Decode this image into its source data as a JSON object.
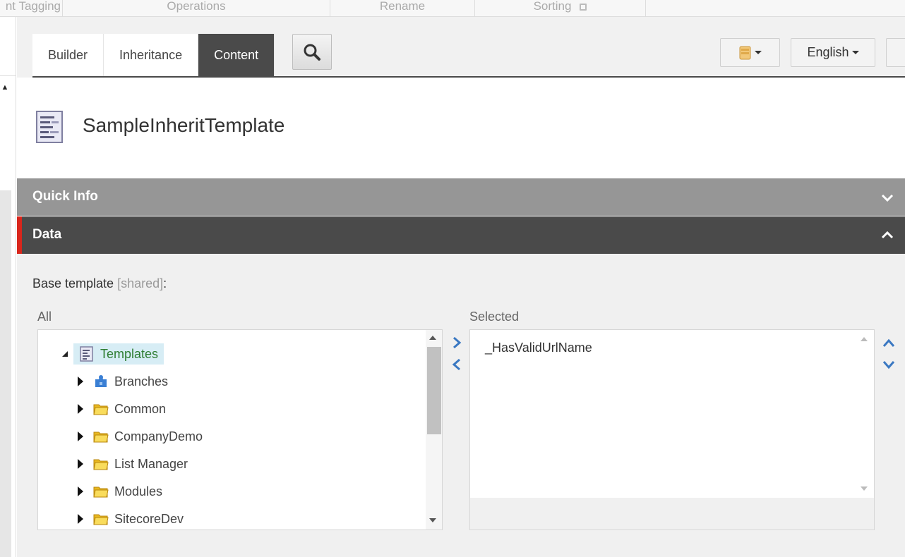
{
  "ribbon": {
    "groups": [
      "nt Tagging",
      "Operations",
      "Rename",
      "Sorting"
    ]
  },
  "header": {
    "tabs": [
      {
        "label": "Builder",
        "active": false
      },
      {
        "label": "Inheritance",
        "active": false
      },
      {
        "label": "Content",
        "active": true
      }
    ],
    "search_icon": "search-icon",
    "database_icon": "database-icon",
    "language": "English"
  },
  "item": {
    "title": "SampleInheritTemplate",
    "icon": "template-icon"
  },
  "sections": {
    "quick_info": "Quick Info",
    "data": "Data"
  },
  "field": {
    "label": "Base template",
    "shared": "[shared]",
    "suffix": ":"
  },
  "lists": {
    "all_label": "All",
    "selected_label": "Selected",
    "tree": {
      "root": {
        "label": "Templates",
        "icon": "template-icon",
        "expanded": true
      },
      "children": [
        {
          "label": "Branches",
          "icon": "branch-puzzle-icon"
        },
        {
          "label": "Common",
          "icon": "folder-icon"
        },
        {
          "label": "CompanyDemo",
          "icon": "folder-icon"
        },
        {
          "label": "List Manager",
          "icon": "folder-icon"
        },
        {
          "label": "Modules",
          "icon": "folder-icon"
        },
        {
          "label": "SitecoreDev",
          "icon": "folder-icon"
        }
      ]
    },
    "selected_items": [
      "_HasValidUrlName"
    ]
  },
  "colors": {
    "accent_red": "#d9261c",
    "dark_header": "#4a4a4a",
    "section_gray": "#969696",
    "arrow_blue": "#3a78c2",
    "tree_selected_bg": "#d7edf5",
    "tree_selected_text": "#2e7d32"
  }
}
